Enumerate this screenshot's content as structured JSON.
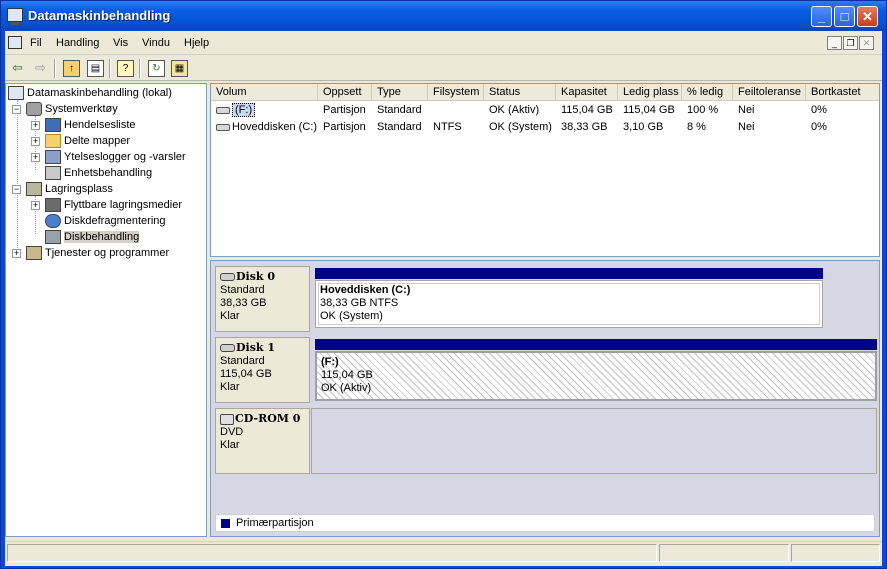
{
  "window": {
    "title": "Datamaskinbehandling",
    "min_label": "_",
    "max_label": "□",
    "close_label": "✕"
  },
  "menu": {
    "items": [
      "Fil",
      "Handling",
      "Vis",
      "Vindu",
      "Hjelp"
    ],
    "mdi_min": "_",
    "mdi_restore": "❐",
    "mdi_close": "✕"
  },
  "toolbar": {
    "back": "⇦",
    "forward": "⇨",
    "up": "↑",
    "show_tree": "▤",
    "properties": "?",
    "refresh": "↻",
    "help": "▦"
  },
  "tree": {
    "root": "Datamaskinbehandling (lokal)",
    "system_tools": "Systemverktøy",
    "event_viewer": "Hendelsesliste",
    "shared_folders": "Delte mapper",
    "perf_logs": "Ytelseslogger og -varsler",
    "device_manager": "Enhetsbehandling",
    "storage": "Lagringsplass",
    "removable_storage": "Flyttbare lagringsmedier",
    "defrag": "Diskdefragmentering",
    "disk_management": "Diskbehandling",
    "services": "Tjenester og programmer",
    "plus": "+",
    "minus": "−"
  },
  "volume_list": {
    "columns": [
      "Volum",
      "Oppsett",
      "Type",
      "Filsystem",
      "Status",
      "Kapasitet",
      "Ledig plass",
      "% ledig",
      "Feiltoleranse",
      "Bortkastet"
    ],
    "rows": [
      [
        "(F:)",
        "Partisjon",
        "Standard",
        "",
        "OK (Aktiv)",
        "115,04 GB",
        "115,04 GB",
        "100 %",
        "Nei",
        "0%"
      ],
      [
        "Hoveddisken (C:)",
        "Partisjon",
        "Standard",
        "NTFS",
        "OK (System)",
        "38,33 GB",
        "3,10 GB",
        "8 %",
        "Nei",
        "0%"
      ]
    ]
  },
  "disks": [
    {
      "name": "Disk 0",
      "type": "Standard",
      "size": "38,33 GB",
      "state": "Klar",
      "partition": {
        "name": "Hoveddisken  (C:)",
        "detail": "38,33 GB NTFS",
        "status": "OK (System)"
      }
    },
    {
      "name": "Disk 1",
      "type": "Standard",
      "size": "115,04 GB",
      "state": "Klar",
      "partition": {
        "name": "(F:)",
        "detail": "115,04 GB",
        "status": "OK (Aktiv)"
      }
    },
    {
      "name": "CD-ROM 0",
      "type": "DVD",
      "size": "",
      "state": "Klar"
    }
  ],
  "legend": {
    "label": "Primærpartisjon",
    "color": "#00008b"
  }
}
